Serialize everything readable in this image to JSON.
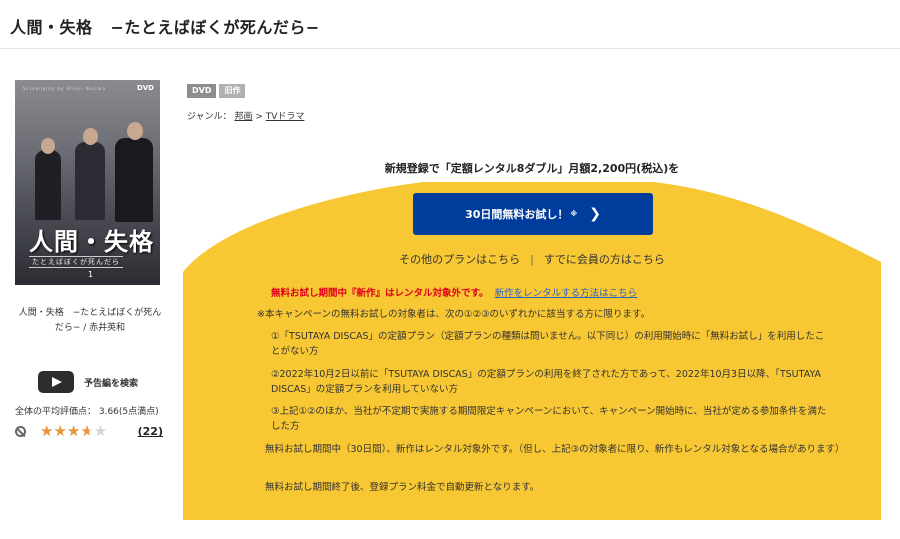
{
  "page": {
    "title_main": "人間・失格",
    "title_sub": "−たとえばぼくが死んだら−"
  },
  "cover": {
    "small_text": "Screenplay by Shinji Nojima",
    "dvd_logo": "DVD",
    "big_title": "人間・失格",
    "subtitle": "たとえばぼくが死んだら",
    "volume": "1"
  },
  "left": {
    "credits": "人間・失格　−たとえばぼくが死んだら− / 赤井英和",
    "trailer_label": "予告編を検索",
    "rating_text": "全体の平均評価点： 3.66(5点満点)",
    "rating_value": 3.66,
    "rating_max": 5,
    "review_count": "(22)",
    "star_glyphs": "★★★★★"
  },
  "product": {
    "badges": [
      "DVD",
      "旧作"
    ],
    "genre_label": "ジャンル：",
    "genre_1": "邦画",
    "genre_arrow": ">",
    "genre_2": "TVドラマ"
  },
  "campaign": {
    "headline": "新規登録で「定額レンタル8ダブル」月額2,200円(税込)を",
    "cta_label": "30日間無料お試し！",
    "cta_note": "※",
    "cta_chevron": "❯",
    "other_plans": "その他のプランはこちら",
    "separator": "|",
    "member_link": "すでに会員の方はこちら",
    "notice_red": "無料お試し期間中『新作』はレンタル対象外です。",
    "notice_link": "新作をレンタルする方法はこちら",
    "condition_intro": "※本キャンペーンの無料お試しの対象者は、次の①②③のいずれかに該当する方に限ります。",
    "condition_1": "①「TSUTAYA DISCAS」の定額プラン（定額プランの種類は問いません。以下同じ）の利用開始時に「無料お試し」を利用したことがない方",
    "condition_2": "②2022年10月2日以前に「TSUTAYA DISCAS」の定額プランの利用を終了された方であって、2022年10月3日以降、「TSUTAYA DISCAS」の定額プランを利用していない方",
    "condition_3": "③上記①②のほか、当社が不定期で実施する期間限定キャンペーンにおいて、キャンペーン開始時に、当社が定める参加条件を満たした方",
    "note_1": "無料お試し期間中（30日間）、新作はレンタル対象外です。（但し、上記③の対象者に限り、新作もレンタル対象となる場合があります）",
    "note_2": "無料お試し期間終了後、登録プラン料金で自動更新となります。"
  },
  "colors": {
    "accent_yellow": "#f8c734",
    "cta_blue": "#003c9c",
    "notice_red": "#e0001b",
    "link_blue": "#2a63c4",
    "star_orange": "#e8953b"
  }
}
